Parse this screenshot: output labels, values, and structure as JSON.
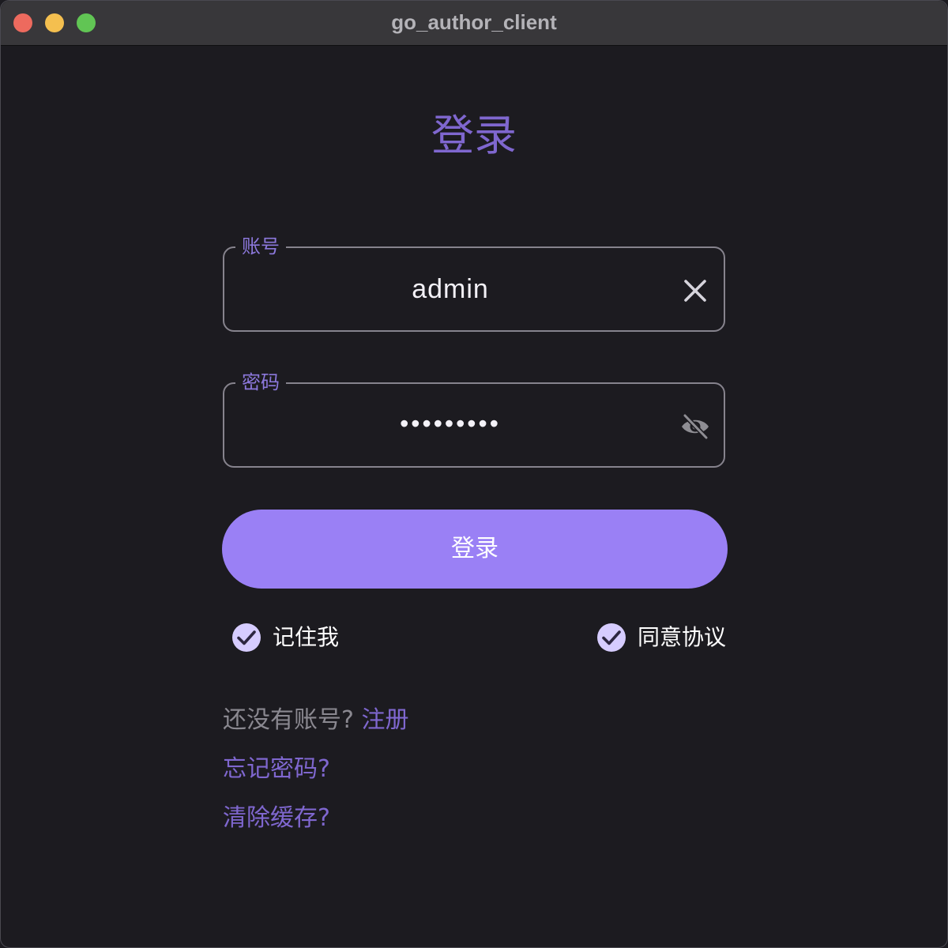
{
  "window": {
    "title": "go_author_client"
  },
  "login": {
    "heading": "登录",
    "account": {
      "label": "账号",
      "value": "admin"
    },
    "password": {
      "label": "密码",
      "value": "•••••••••"
    },
    "submit_label": "登录",
    "remember_me": {
      "label": "记住我",
      "checked": true
    },
    "agree_terms": {
      "label": "同意协议",
      "checked": true
    },
    "register_prompt": "还没有账号?",
    "register_link": "注册",
    "forgot_password": "忘记密码?",
    "clear_cache": "清除缓存?"
  },
  "colors": {
    "accent": "#7f67cf",
    "button": "#9a80f5",
    "background": "#1c1b20",
    "titlebar": "#38373a"
  },
  "icons": {
    "clear": "close-icon",
    "password_visibility": "eye-off-icon",
    "checkbox": "check-circle-icon"
  }
}
